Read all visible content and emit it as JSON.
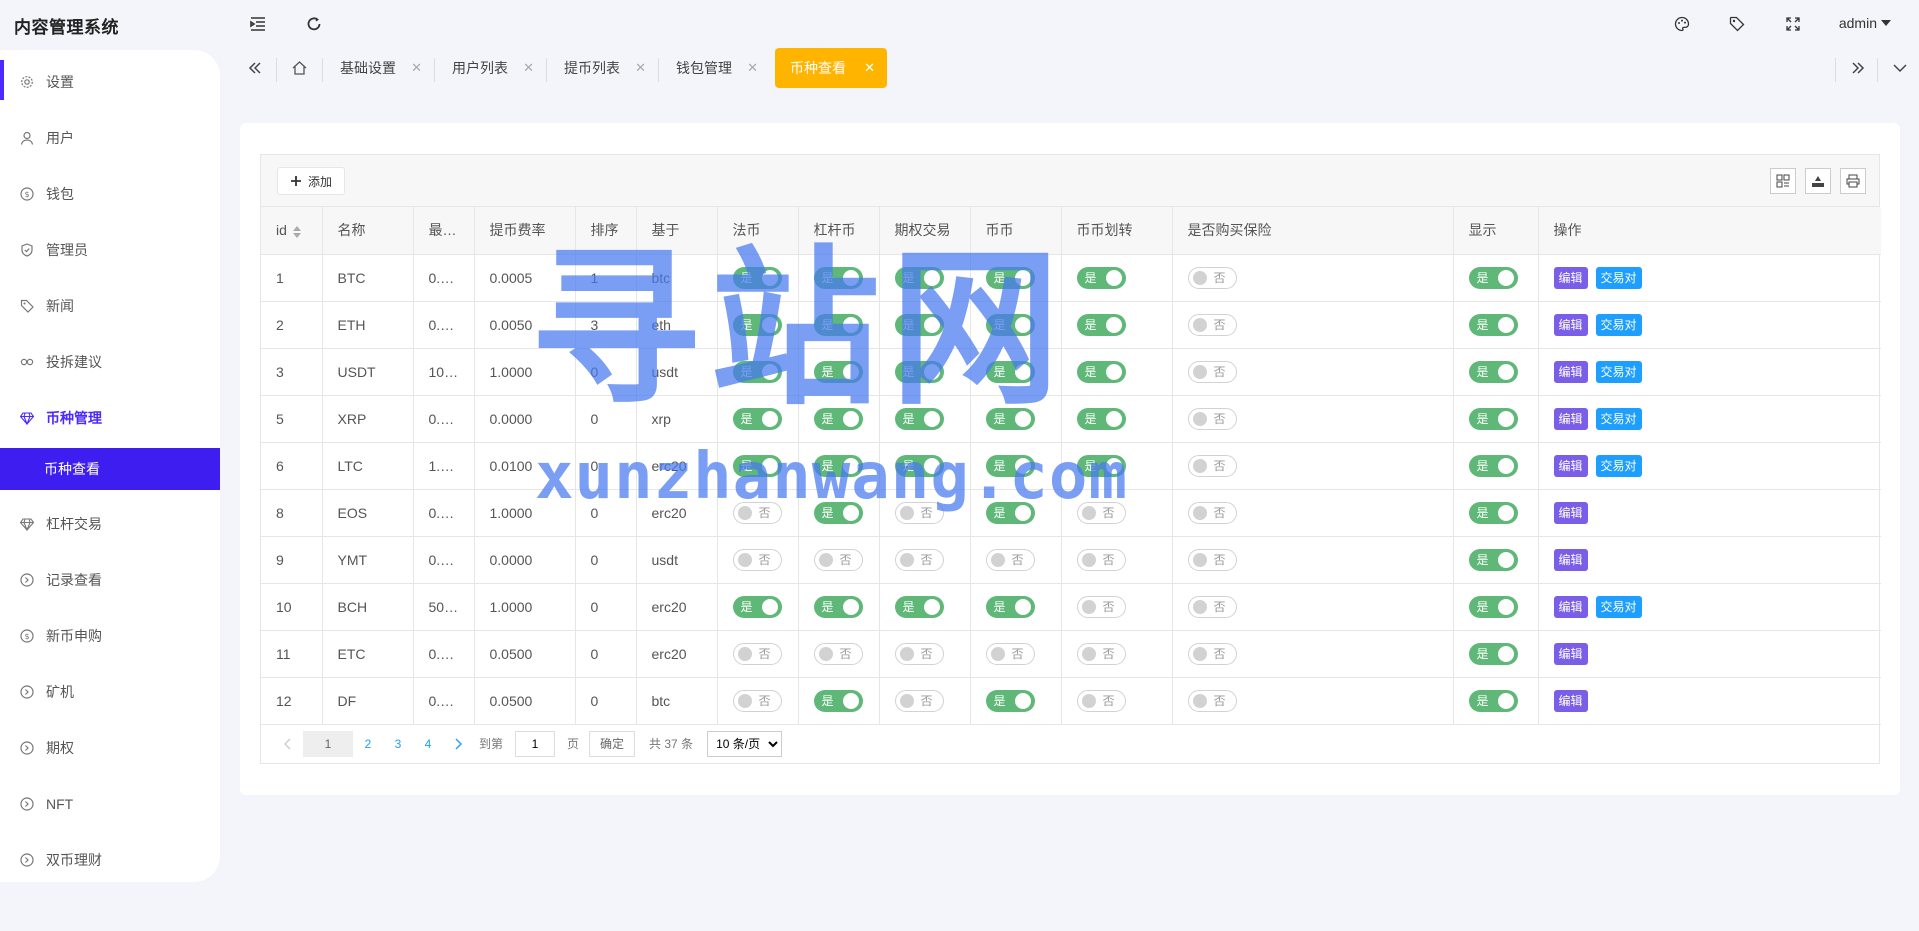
{
  "app": {
    "title": "内容管理系统",
    "user": "admin"
  },
  "sidebar": {
    "items": [
      {
        "label": "设置",
        "icon": "gear-icon"
      },
      {
        "label": "用户",
        "icon": "user-icon"
      },
      {
        "label": "钱包",
        "icon": "dollar-icon"
      },
      {
        "label": "管理员",
        "icon": "shield-icon"
      },
      {
        "label": "新闻",
        "icon": "tag-icon"
      },
      {
        "label": "投拆建议",
        "icon": "link-icon"
      },
      {
        "label": "币种管理",
        "icon": "diamond-icon"
      },
      {
        "label": "币种查看",
        "icon": ""
      },
      {
        "label": "杠杆交易",
        "icon": "diamond-icon"
      },
      {
        "label": "记录查看",
        "icon": "circle-arrow-icon"
      },
      {
        "label": "新币申购",
        "icon": "dollar-icon"
      },
      {
        "label": "矿机",
        "icon": "circle-arrow-icon"
      },
      {
        "label": "期权",
        "icon": "circle-arrow-icon"
      },
      {
        "label": "NFT",
        "icon": "circle-arrow-icon"
      },
      {
        "label": "双币理财",
        "icon": "circle-arrow-icon"
      }
    ]
  },
  "tabs": [
    {
      "label": "基础设置"
    },
    {
      "label": "用户列表"
    },
    {
      "label": "提币列表"
    },
    {
      "label": "钱包管理"
    },
    {
      "label": "币种查看"
    }
  ],
  "toolbar": {
    "add_label": "添加"
  },
  "table": {
    "headers": [
      "id",
      "名称",
      "最…",
      "提币费率",
      "排序",
      "基于",
      "法币",
      "杠杆币",
      "期权交易",
      "币币",
      "币币划转",
      "是否购买保险",
      "显示",
      "操作"
    ],
    "on_label": "是",
    "off_label": "否",
    "edit_label": "编辑",
    "pair_label": "交易对",
    "rows": [
      {
        "id": "1",
        "name": "BTC",
        "min": "0.…",
        "fee": "0.0005",
        "sort": "1",
        "base": "btc",
        "fiat": true,
        "lever": true,
        "option": true,
        "coin": true,
        "transfer": true,
        "insure": false,
        "show": true,
        "pair": true
      },
      {
        "id": "2",
        "name": "ETH",
        "min": "0.…",
        "fee": "0.0050",
        "sort": "3",
        "base": "eth",
        "fiat": true,
        "lever": true,
        "option": true,
        "coin": true,
        "transfer": true,
        "insure": false,
        "show": true,
        "pair": true
      },
      {
        "id": "3",
        "name": "USDT",
        "min": "10…",
        "fee": "1.0000",
        "sort": "0",
        "base": "usdt",
        "fiat": true,
        "lever": true,
        "option": true,
        "coin": true,
        "transfer": true,
        "insure": false,
        "show": true,
        "pair": true
      },
      {
        "id": "5",
        "name": "XRP",
        "min": "0.…",
        "fee": "0.0000",
        "sort": "0",
        "base": "xrp",
        "fiat": true,
        "lever": true,
        "option": true,
        "coin": true,
        "transfer": true,
        "insure": false,
        "show": true,
        "pair": true
      },
      {
        "id": "6",
        "name": "LTC",
        "min": "1.…",
        "fee": "0.0100",
        "sort": "0",
        "base": "erc20",
        "fiat": true,
        "lever": true,
        "option": true,
        "coin": true,
        "transfer": true,
        "insure": false,
        "show": true,
        "pair": true
      },
      {
        "id": "8",
        "name": "EOS",
        "min": "0.…",
        "fee": "1.0000",
        "sort": "0",
        "base": "erc20",
        "fiat": false,
        "lever": true,
        "option": false,
        "coin": true,
        "transfer": false,
        "insure": false,
        "show": true,
        "pair": false
      },
      {
        "id": "9",
        "name": "YMT",
        "min": "0.…",
        "fee": "0.0000",
        "sort": "0",
        "base": "usdt",
        "fiat": false,
        "lever": false,
        "option": false,
        "coin": false,
        "transfer": false,
        "insure": false,
        "show": true,
        "pair": false
      },
      {
        "id": "10",
        "name": "BCH",
        "min": "50…",
        "fee": "1.0000",
        "sort": "0",
        "base": "erc20",
        "fiat": true,
        "lever": true,
        "option": true,
        "coin": true,
        "transfer": false,
        "insure": false,
        "show": true,
        "pair": true
      },
      {
        "id": "11",
        "name": "ETC",
        "min": "0.…",
        "fee": "0.0500",
        "sort": "0",
        "base": "erc20",
        "fiat": false,
        "lever": false,
        "option": false,
        "coin": false,
        "transfer": false,
        "insure": false,
        "show": true,
        "pair": false
      },
      {
        "id": "12",
        "name": "DF",
        "min": "0.…",
        "fee": "0.0500",
        "sort": "0",
        "base": "btc",
        "fiat": false,
        "lever": true,
        "option": false,
        "coin": true,
        "transfer": false,
        "insure": false,
        "show": true,
        "pair": false
      }
    ]
  },
  "pager": {
    "pages": [
      "1",
      "2",
      "3",
      "4"
    ],
    "goto_label": "到第",
    "goto_value": "1",
    "page_unit": "页",
    "confirm_label": "确定",
    "total_label": "共 37 条",
    "size_label": "10 条/页"
  },
  "watermark": {
    "main": "寻站网",
    "sub": "xunzhanwang.com"
  },
  "colors": {
    "accent": "#4b2aff",
    "tab_active": "#ffb400",
    "switch_on": "#5fb878",
    "edit": "#7b5ee8",
    "pair": "#1e9fff"
  }
}
